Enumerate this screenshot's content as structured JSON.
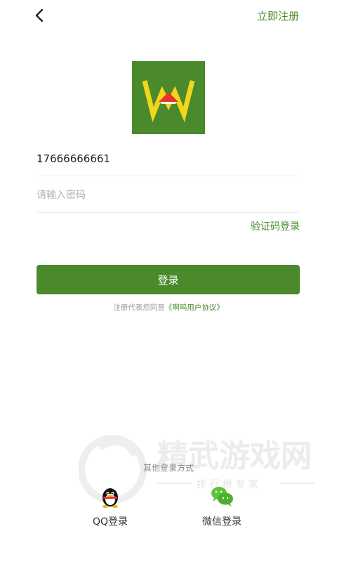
{
  "header": {
    "back_icon": "chevron-left-icon",
    "register_label": "立即注册"
  },
  "login": {
    "phone_value": "17666666661",
    "password_placeholder": "请输入密码",
    "sms_login_label": "验证码登录",
    "submit_label": "登录"
  },
  "agreement": {
    "prefix": "注册代表您同意",
    "link_label": "《啊呜用户协议》"
  },
  "other_login": {
    "title": "其他登录方式",
    "options": [
      {
        "label": "QQ登录",
        "icon": "qq-penguin-icon"
      },
      {
        "label": "微信登录",
        "icon": "wechat-icon"
      }
    ]
  },
  "watermark": {
    "title": "精武游戏网",
    "subtitle": "排 行 榜 专 家"
  },
  "colors": {
    "brand_green": "#4a8a2c",
    "logo_yellow": "#f2d61c",
    "logo_red": "#e8332b"
  }
}
